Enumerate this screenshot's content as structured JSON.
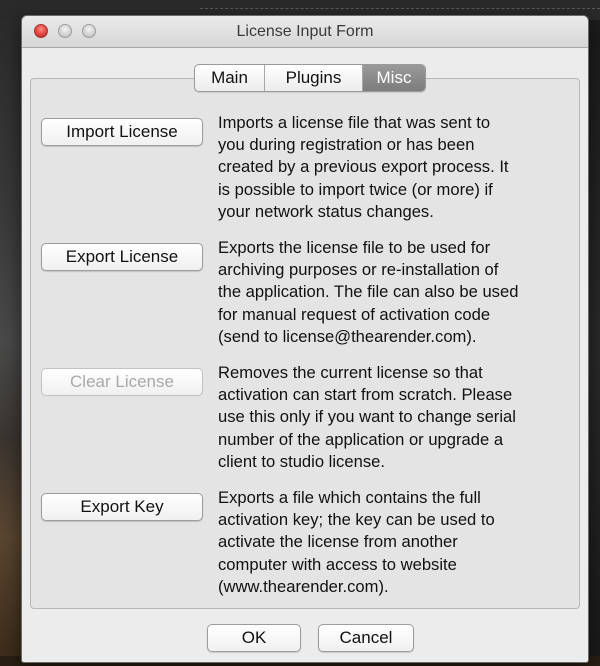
{
  "window": {
    "title": "License Input Form"
  },
  "tabs": [
    {
      "label": "Main",
      "active": false
    },
    {
      "label": "Plugins",
      "active": false
    },
    {
      "label": "Misc",
      "active": true
    }
  ],
  "actions": [
    {
      "button_label": "Import License",
      "enabled": true,
      "description_lines": [
        "Imports a license file that was sent to",
        "you during registration or has been",
        "created by a previous export process. It",
        "is possible to import twice (or more) if",
        "your network status changes."
      ]
    },
    {
      "button_label": "Export License",
      "enabled": true,
      "description_lines": [
        "Exports the license file to be used for",
        "archiving purposes or re-installation of",
        "the application. The file can also be used",
        "for manual request of activation code",
        "(send to license@thearender.com)."
      ]
    },
    {
      "button_label": "Clear License",
      "enabled": false,
      "description_lines": [
        "Removes the current license so that",
        "activation can start from scratch. Please",
        "use this only if you want to change serial",
        "number of the application or upgrade a",
        "client to studio license."
      ]
    },
    {
      "button_label": "Export Key",
      "enabled": true,
      "description_lines": [
        "Exports a file which contains the full",
        "activation key; the key can be used to",
        "activate the license from another",
        "computer with access to website",
        "(www.thearender.com)."
      ]
    }
  ],
  "footer": {
    "ok_label": "OK",
    "cancel_label": "Cancel"
  },
  "colors": {
    "window_bg": "#ececec",
    "active_tab": "#8a8a8a",
    "close_button": "#e0443e",
    "disabled_text": "#a9a9a9"
  }
}
